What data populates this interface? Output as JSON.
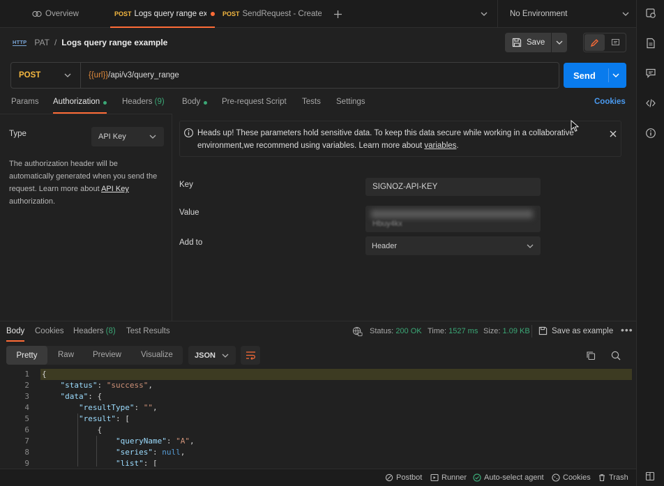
{
  "tabs": [
    {
      "method": "",
      "label": "Overview"
    },
    {
      "method": "POST",
      "label": "Logs query range exar",
      "unsaved": true
    },
    {
      "method": "POST",
      "label": "SendRequest - Create a"
    }
  ],
  "environment": "No Environment",
  "breadcrumb": {
    "badge": "HTTP",
    "workspace": "PAT",
    "separator": "/",
    "request": "Logs query range example"
  },
  "save_label": "Save",
  "request": {
    "method": "POST",
    "url_var": "{{url}}",
    "url_path": "/api/v3/query_range",
    "send_label": "Send"
  },
  "req_tabs": {
    "params": "Params",
    "authorization": "Authorization",
    "headers": "Headers",
    "headers_count": "(9)",
    "body": "Body",
    "prerequest": "Pre-request Script",
    "tests": "Tests",
    "settings": "Settings",
    "cookies": "Cookies"
  },
  "auth": {
    "type_label": "Type",
    "type_value": "API Key",
    "desc": "The authorization header will be automatically generated when you send the request. Learn more about",
    "desc_link": "API Key",
    "desc_end": "authorization.",
    "alert_text": "Heads up! These parameters hold sensitive data. To keep this data secure while working in a collaborative environment,we recommend using variables. Learn more about",
    "alert_link": "variables",
    "alert_end": ".",
    "key_label": "Key",
    "key_value": "SIGNOZ-API-KEY",
    "value_label": "Value",
    "value_value": "Hbuy4kx",
    "addto_label": "Add to",
    "addto_value": "Header"
  },
  "response": {
    "tabs": {
      "body": "Body",
      "cookies": "Cookies",
      "headers": "Headers",
      "headers_count": "(8)",
      "tests": "Test Results"
    },
    "status_label": "Status:",
    "status_value": "200 OK",
    "time_label": "Time:",
    "time_value": "1527 ms",
    "size_label": "Size:",
    "size_value": "1.09 KB",
    "save_example": "Save as example",
    "view_modes": [
      "Pretty",
      "Raw",
      "Preview",
      "Visualize"
    ],
    "format": "JSON",
    "line_numbers": [
      "1",
      "2",
      "3",
      "4",
      "5",
      "6",
      "7",
      "8",
      "9"
    ]
  },
  "statusbar": {
    "postbot": "Postbot",
    "runner": "Runner",
    "agent": "Auto-select agent",
    "cookies": "Cookies",
    "trash": "Trash"
  }
}
